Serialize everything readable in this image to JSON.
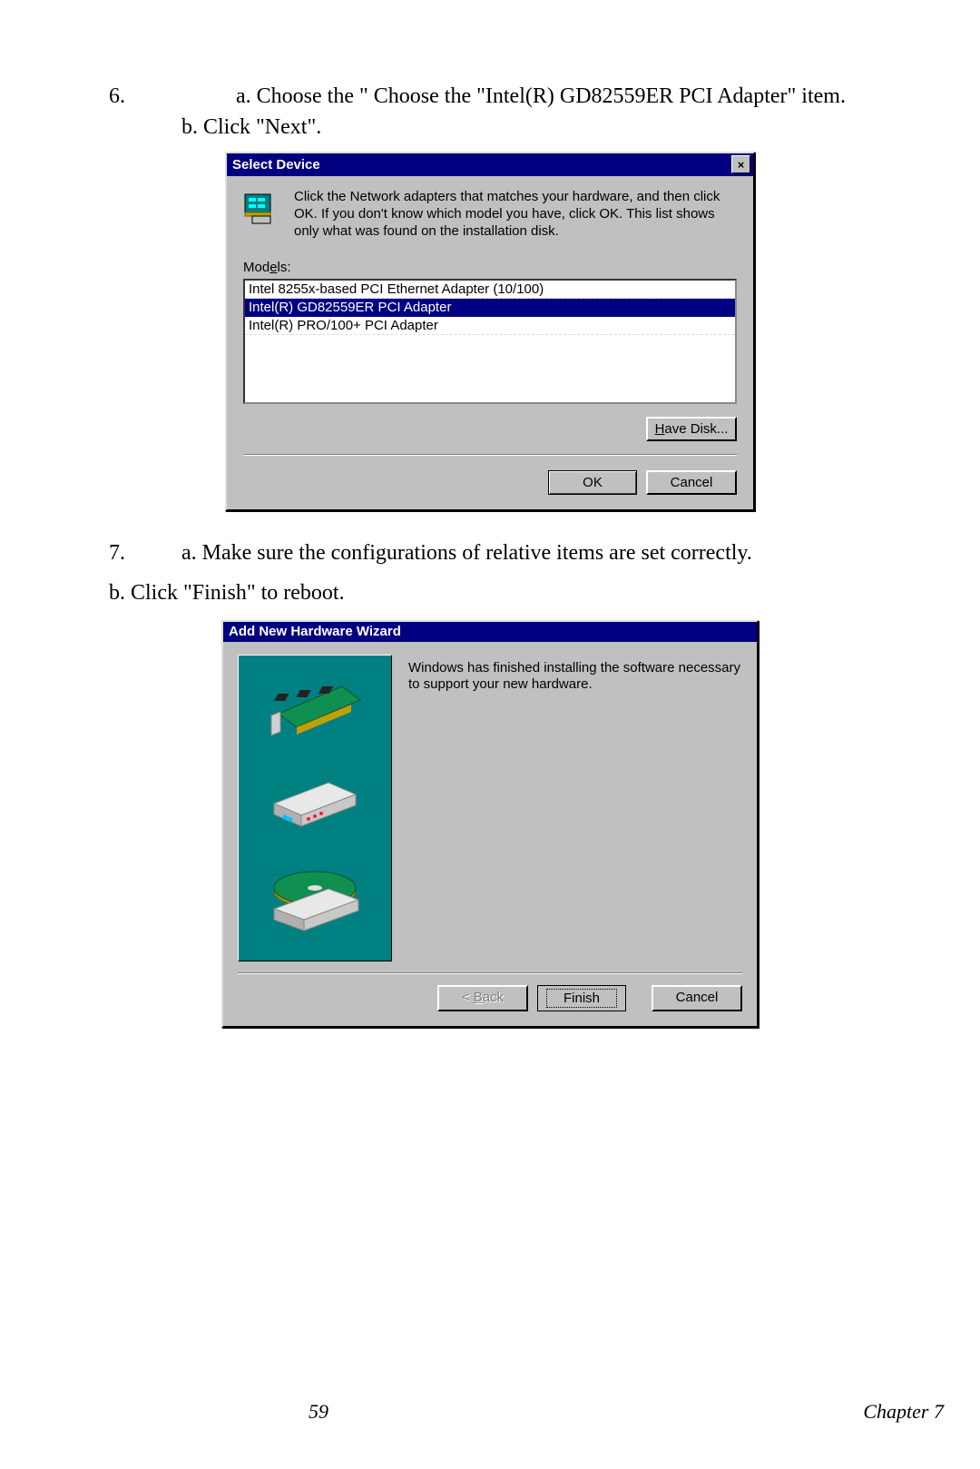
{
  "step6": {
    "num": "6.",
    "line_a": "a. Choose the \" Choose the \"Intel(R) GD82559ER PCI Adapter\" item.",
    "line_b": "b. Click \"Next\"."
  },
  "dialog1": {
    "title": "Select Device",
    "close": "×",
    "instruction": "Click the Network adapters that matches your hardware, and then click OK. If you don't know which model you have, click OK. This list shows only what was found on the installation disk.",
    "models_label_pre": "Mod",
    "models_label_u": "e",
    "models_label_post": "ls:",
    "items": [
      "Intel 8255x-based PCI Ethernet Adapter (10/100)",
      "Intel(R) GD82559ER PCI Adapter",
      "Intel(R) PRO/100+ PCI Adapter"
    ],
    "have_disk_u": "H",
    "have_disk_post": "ave Disk...",
    "ok": "OK",
    "cancel": "Cancel"
  },
  "step7": {
    "num": "7.",
    "line_a": "a. Make sure the configurations of relative items are set correctly.",
    "line_b": "b. Click \"Finish\" to reboot."
  },
  "dialog2": {
    "title": "Add New Hardware Wizard",
    "message": "Windows has finished installing the software necessary to support your new hardware.",
    "back_pre": "< ",
    "back_u": "B",
    "back_post": "ack",
    "finish": "Finish",
    "cancel": "Cancel"
  },
  "footer": {
    "page": "59",
    "chapter": "Chapter 7"
  }
}
